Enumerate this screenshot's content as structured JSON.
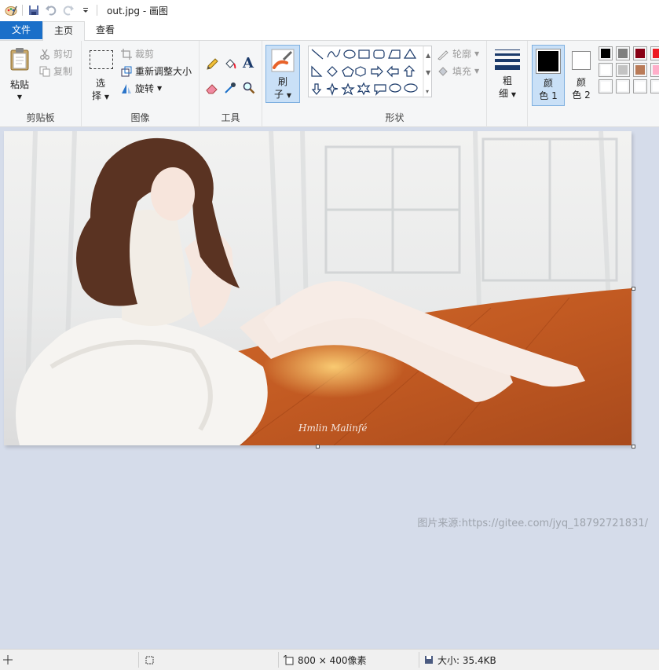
{
  "window": {
    "title": "out.jpg - 画图"
  },
  "tabs": {
    "file": "文件",
    "home": "主页",
    "view": "查看"
  },
  "clipboard": {
    "paste": "粘贴",
    "cut": "剪切",
    "copy": "复制",
    "label": "剪贴板"
  },
  "image_group": {
    "select_1": "选",
    "select_2": "择",
    "crop": "裁剪",
    "resize": "重新调整大小",
    "rotate": "旋转",
    "label": "图像"
  },
  "tools": {
    "label": "工具"
  },
  "brushes": {
    "label_1": "刷",
    "label_2": "子"
  },
  "shapes": {
    "outline": "轮廓",
    "fill": "填充",
    "label": "形状"
  },
  "size": {
    "label_1": "粗",
    "label_2": "细"
  },
  "color1": {
    "label_1": "颜",
    "label_2": "色 1",
    "color": "#000000"
  },
  "color2": {
    "label_1": "颜",
    "label_2": "色 2",
    "color": "#ffffff"
  },
  "palette": [
    "#000000",
    "#7f7f7f",
    "#880015",
    "#ed1c24",
    "#ffffff",
    "#c3c3c3",
    "#b97a57",
    "#ffaec9",
    "#ffffff",
    "#ffffff",
    "#ffffff",
    "#ffffff"
  ],
  "canvas": {
    "signature_text": "Hmlin Malinfé"
  },
  "watermark": "图片来源:https://gitee.com/jyq_18792721831/",
  "status": {
    "dimensions": "800 × 400像素",
    "filesize": "大小: 35.4KB"
  }
}
